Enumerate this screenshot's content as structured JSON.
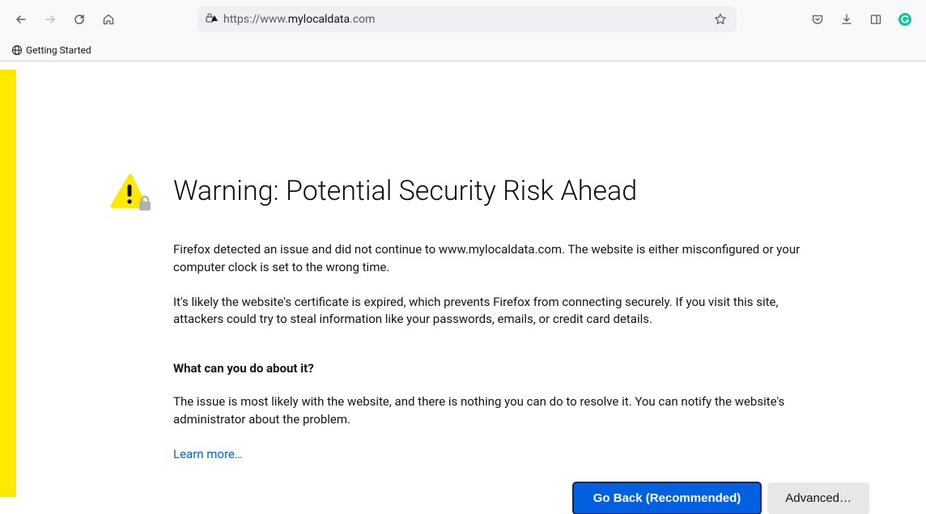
{
  "urlbar": {
    "prefix": "https://www.",
    "domain": "mylocaldata",
    "suffix": ".com"
  },
  "bookmarks": {
    "item0": "Getting Started"
  },
  "warning": {
    "title": "Warning: Potential Security Risk Ahead",
    "p1": "Firefox detected an issue and did not continue to www.mylocaldata.com. The website is either misconfigured or your computer clock is set to the wrong time.",
    "p2": "It's likely the website's certificate is expired, which prevents Firefox from connecting securely. If you visit this site, attackers could try to steal information like your passwords, emails, or credit card details.",
    "subheading": "What can you do about it?",
    "p3": "The issue is most likely with the website, and there is nothing you can do to resolve it. You can notify the website's administrator about the problem.",
    "learn_more": "Learn more…",
    "primary_button": "Go Back (Recommended)",
    "secondary_button": "Advanced…"
  }
}
